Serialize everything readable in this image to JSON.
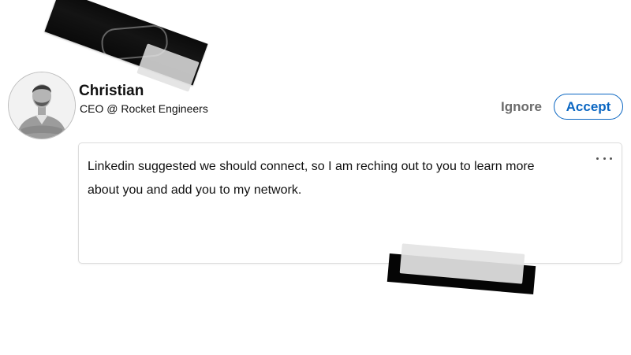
{
  "profile": {
    "name": "Christian",
    "headline": "CEO @ Rocket Engineers"
  },
  "actions": {
    "ignore_label": "Ignore",
    "accept_label": "Accept"
  },
  "message": {
    "text": "Linkedin suggested we should connect, so I am reching out to you to learn more about you and add you to my network."
  },
  "icons": {
    "more": "more-horizontal-icon",
    "avatar": "avatar-photo"
  },
  "colors": {
    "accent": "#0a66c2",
    "ignore": "#6b6b6b",
    "text": "#111111"
  }
}
